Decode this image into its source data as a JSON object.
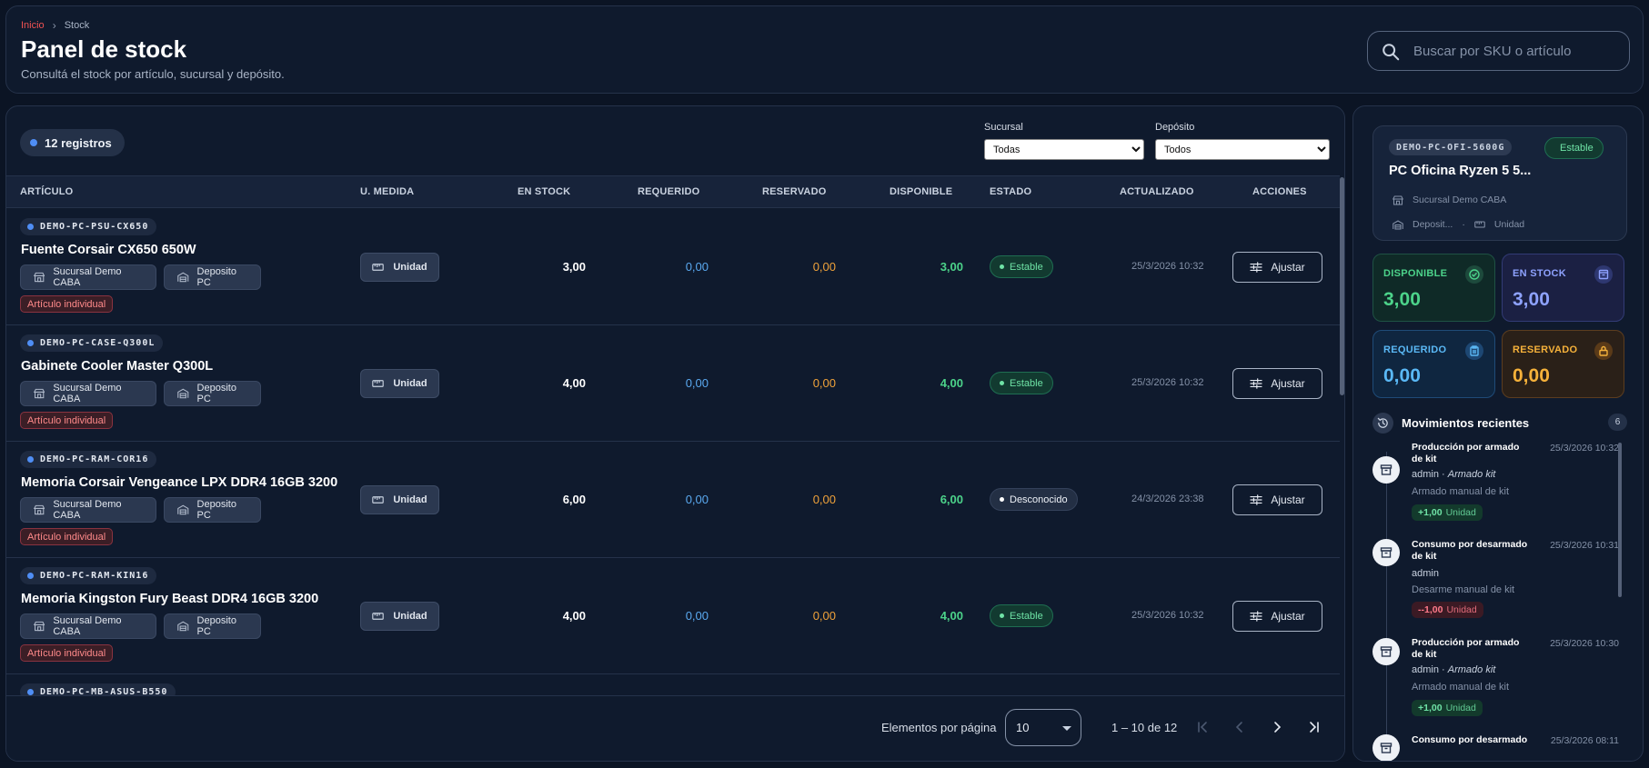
{
  "breadcrumb": {
    "home": "Inicio",
    "sep": "›",
    "current": "Stock"
  },
  "header": {
    "title": "Panel de stock",
    "subtitle": "Consultá el stock por artículo, sucursal y depósito.",
    "search_placeholder": "Buscar por SKU o artículo"
  },
  "table": {
    "count_label": "12 registros",
    "filters": {
      "sucursal_label": "Sucursal",
      "sucursal_value": "Todas",
      "deposito_label": "Depósito",
      "deposito_value": "Todos"
    },
    "columns": [
      "ARTÍCULO",
      "U. MEDIDA",
      "EN STOCK",
      "REQUERIDO",
      "RESERVADO",
      "DISPONIBLE",
      "ESTADO",
      "ACTUALIZADO",
      "ACCIONES"
    ],
    "rows": [
      {
        "sku": "DEMO-PC-PSU-CX650",
        "name": "Fuente Corsair CX650 650W",
        "branch": "Sucursal Demo CABA",
        "deposit": "Deposito PC",
        "tag": "Artículo individual",
        "unit": "Unidad",
        "stock": "3,00",
        "required": "0,00",
        "reserved": "0,00",
        "available": "3,00",
        "status": "Estable",
        "updated": "25/3/2026 10:32",
        "action": "Ajustar"
      },
      {
        "sku": "DEMO-PC-CASE-Q300L",
        "name": "Gabinete Cooler Master Q300L",
        "branch": "Sucursal Demo CABA",
        "deposit": "Deposito PC",
        "tag": "Artículo individual",
        "unit": "Unidad",
        "stock": "4,00",
        "required": "0,00",
        "reserved": "0,00",
        "available": "4,00",
        "status": "Estable",
        "updated": "25/3/2026 10:32",
        "action": "Ajustar"
      },
      {
        "sku": "DEMO-PC-RAM-COR16",
        "name": "Memoria Corsair Vengeance LPX DDR4 16GB 3200",
        "branch": "Sucursal Demo CABA",
        "deposit": "Deposito PC",
        "tag": "Artículo individual",
        "unit": "Unidad",
        "stock": "6,00",
        "required": "0,00",
        "reserved": "0,00",
        "available": "6,00",
        "status": "Desconocido",
        "updated": "24/3/2026 23:38",
        "action": "Ajustar"
      },
      {
        "sku": "DEMO-PC-RAM-KIN16",
        "name": "Memoria Kingston Fury Beast DDR4 16GB 3200",
        "branch": "Sucursal Demo CABA",
        "deposit": "Deposito PC",
        "tag": "Artículo individual",
        "unit": "Unidad",
        "stock": "4,00",
        "required": "0,00",
        "reserved": "0,00",
        "available": "4,00",
        "status": "Estable",
        "updated": "25/3/2026 10:32",
        "action": "Ajustar"
      },
      {
        "sku": "DEMO-PC-MB-ASUS-B550"
      }
    ],
    "footer": {
      "per_page_label": "Elementos por página",
      "per_page_value": "10",
      "range_label": "1 – 10 de 12"
    }
  },
  "side": {
    "product": {
      "sku": "DEMO-PC-OFI-5600G",
      "status": "Estable",
      "name": "PC Oficina Ryzen 5 5...",
      "branch": "Sucursal Demo CABA",
      "deposit": "Deposit...",
      "meta_sep": "·",
      "unit": "Unidad"
    },
    "kpis": {
      "available_label": "DISPONIBLE",
      "available_value": "3,00",
      "stock_label": "EN STOCK",
      "stock_value": "3,00",
      "required_label": "REQUERIDO",
      "required_value": "0,00",
      "reserved_label": "RESERVADO",
      "reserved_value": "0,00"
    },
    "movements": {
      "title": "Movimientos recientes",
      "count": "6",
      "items": [
        {
          "title": "Producción por armado de kit",
          "time": "25/3/2026 10:32",
          "user": "admin",
          "user_detail": "Armado kit",
          "desc": "Armado manual de kit",
          "qty": "+1,00",
          "unit": "Unidad"
        },
        {
          "title": "Consumo por desarmado de kit",
          "time": "25/3/2026 10:31",
          "user": "admin",
          "user_detail": "",
          "desc": "Desarme manual de kit",
          "qty": "--1,00",
          "unit": "Unidad"
        },
        {
          "title": "Producción por armado de kit",
          "time": "25/3/2026 10:30",
          "user": "admin",
          "user_detail": "Armado kit",
          "desc": "Armado manual de kit",
          "qty": "+1,00",
          "unit": "Unidad"
        },
        {
          "title": "Consumo por desarmado",
          "time": "25/3/2026 08:11"
        }
      ]
    }
  }
}
